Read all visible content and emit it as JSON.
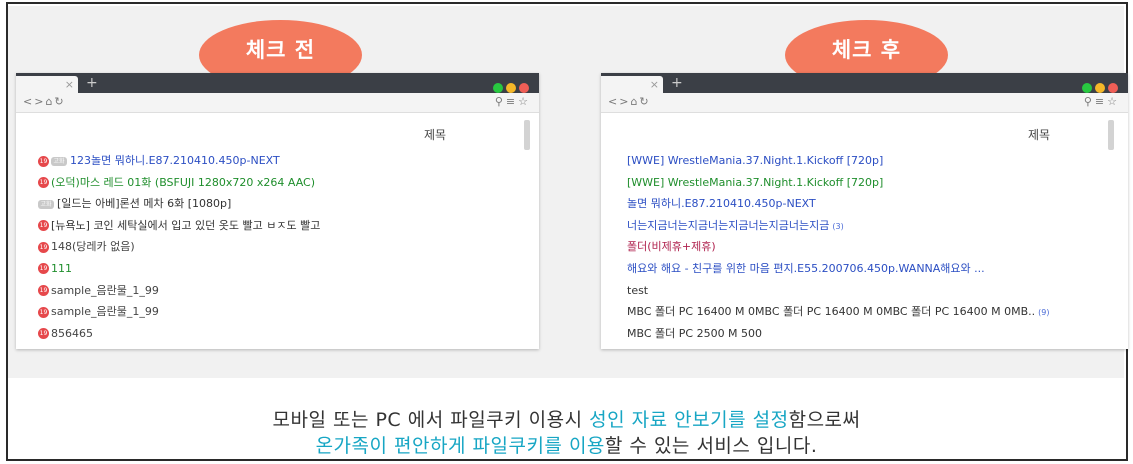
{
  "labels": {
    "before": "체크 전",
    "after": "체크 후"
  },
  "browser": {
    "tab_close": "×",
    "tab_add": "+",
    "nav_back": "<",
    "nav_forward": ">",
    "nav_home": "⌂",
    "nav_refresh": "↻",
    "nav_pin": "⚲",
    "nav_menu": "≡",
    "nav_star": "☆"
  },
  "column_header": "제목",
  "badge_text": "19",
  "before_list": [
    {
      "tag": "고화",
      "text": "123놀면 뭐하니.E87.210410.450p-NEXT"
    },
    {
      "text": "(오덕)마스 레드 01화 (BSFUJI 1280x720 x264 AAC)"
    },
    {
      "tag": "고화",
      "text": "[일드는 아베]론션 메차 6화 [1080p]"
    },
    {
      "text": "[뉴욕노] 코인 세탁실에서 입고 있던 옷도 빨고 ㅂㅈ도 빨고"
    },
    {
      "text": "148(당레카 없음)"
    },
    {
      "text": "111"
    },
    {
      "text": "sample_음란물_1_99"
    },
    {
      "text": "sample_음란물_1_99"
    },
    {
      "text": "856465"
    }
  ],
  "after_list": [
    {
      "text": "[WWE] WrestleMania.37.Night.1.Kickoff [720p]"
    },
    {
      "text": "[WWE] WrestleMania.37.Night.1.Kickoff [720p]"
    },
    {
      "text": "놀면 뭐하니.E87.210410.450p-NEXT"
    },
    {
      "text": "너는지금너는지금너는지금너는지금너는지금",
      "count": "(3)"
    },
    {
      "text": "폴더(비제휴+제휴)"
    },
    {
      "text": "해요와 해요 - 친구를 위한 마음 편지.E55.200706.450p.WANNA해요와 ..."
    },
    {
      "text": "test"
    },
    {
      "text": "MBC 폴더 PC 16400 M 0MBC 폴더 PC 16400 M 0MBC 폴더 PC 16400 M 0MB..",
      "count": "(9)"
    },
    {
      "text": "MBC 폴더 PC 2500 M 500"
    }
  ],
  "caption": {
    "line1_a": "모바일 또는 PC 에서 파일쿠키 이용시 ",
    "line1_hl": "성인 자료 안보기를 설정",
    "line1_b": "함으로써",
    "line2_hl": "온가족이 편안하게 파일쿠키를 이용",
    "line2_b": "할 수 있는 서비스 입니다."
  },
  "colors": {
    "accent": "#f37a5e",
    "highlight": "#17a6c4",
    "adult_icon": "#e6484b",
    "link_blue": "#2b4ec3",
    "link_green": "#1f8e2c",
    "link_red": "#b0234f"
  }
}
